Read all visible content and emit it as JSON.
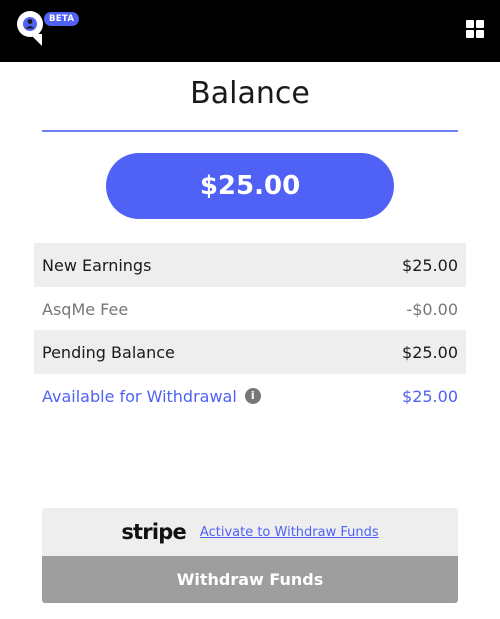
{
  "header": {
    "logo_icon": "q-logo-icon",
    "beta_badge": "BETA",
    "menu_icon": "grid-menu-icon"
  },
  "page": {
    "title": "Balance",
    "total_amount": "$25.00"
  },
  "rows": [
    {
      "label": "New Earnings",
      "value": "$25.00"
    },
    {
      "label": "AsqMe Fee",
      "value": "-$0.00"
    },
    {
      "label": "Pending Balance",
      "value": "$25.00"
    },
    {
      "label": "Available for Withdrawal",
      "value": "$25.00"
    }
  ],
  "payout": {
    "provider_logo_text": "stripe",
    "activate_link": "Activate to Withdraw Funds",
    "withdraw_label": "Withdraw Funds"
  },
  "colors": {
    "accent": "#4f62f5",
    "topbar": "#000000",
    "row_shade": "#eeeeee",
    "disabled_button": "#9e9e9e"
  }
}
